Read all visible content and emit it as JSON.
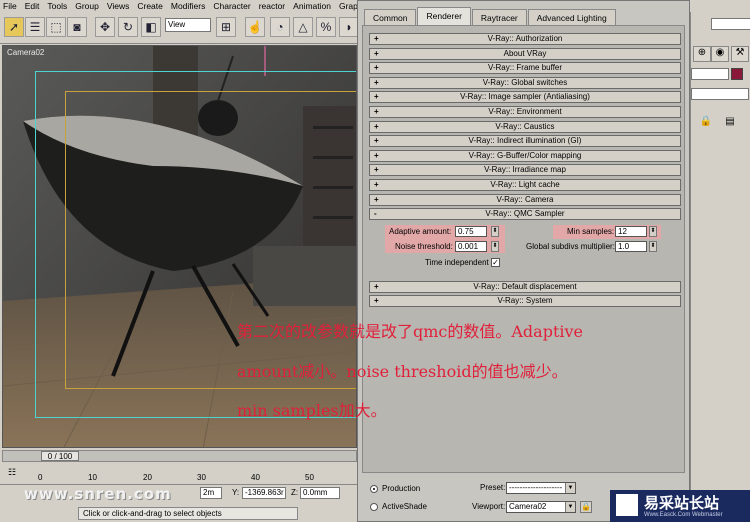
{
  "menu": [
    "File",
    "Edit",
    "Tools",
    "Group",
    "Views",
    "Create",
    "Modifiers",
    "Character",
    "reactor",
    "Animation",
    "Graph Ed"
  ],
  "toolbar": {
    "view_select": "View"
  },
  "viewport": {
    "label": "Camera02"
  },
  "dialog": {
    "tabs": [
      "Common",
      "Renderer",
      "Raytracer",
      "Advanced Lighting"
    ],
    "active_tab": "Renderer",
    "rollouts_before": [
      "V-Ray:: Authorization",
      "About VRay",
      "V-Ray:: Frame buffer",
      "V-Ray:: Global switches",
      "V-Ray:: Image sampler (Antialiasing)",
      "V-Ray:: Environment",
      "V-Ray:: Caustics",
      "V-Ray:: Indirect illumination (GI)",
      "V-Ray:: G-Buffer/Color mapping",
      "V-Ray:: Irradiance map",
      "V-Ray:: Light cache",
      "V-Ray:: Camera"
    ],
    "qmc": {
      "title": "V-Ray:: QMC Sampler",
      "adaptive_amount_label": "Adaptive amount:",
      "adaptive_amount": "0.75",
      "noise_threshold_label": "Noise threshold:",
      "noise_threshold": "0.001",
      "time_independent_label": "Time independent",
      "time_independent_check": "✓",
      "min_samples_label": "Min samples:",
      "min_samples": "12",
      "global_subdivs_label": "Global subdivs multiplier:",
      "global_subdivs": "1.0"
    },
    "rollouts_after": [
      "V-Ray:: Default displacement",
      "V-Ray:: System"
    ],
    "bottom": {
      "production": "Production",
      "activeshade": "ActiveShade",
      "preset_label": "Preset:",
      "preset_value": "--------------------",
      "viewport_label": "Viewport:",
      "viewport_value": "Camera02"
    }
  },
  "annotation": {
    "line1": "第二次的改参数就是改了qmc的数值。Adaptive",
    "line2": "amount减小。noise threshoid的值也减少。",
    "line3": "min samples加大。"
  },
  "timeline": {
    "thumb": "0 / 100",
    "ticks": [
      "0",
      "10",
      "20",
      "30",
      "40",
      "50"
    ]
  },
  "status": {
    "prompt": "Click or click-and-drag to select objects",
    "y_label": "Y:",
    "y_value": "-1369.863r",
    "z_label": "Z:",
    "z_value": "0.0mm",
    "x_value": "2m"
  },
  "watermark": "www.snren.com",
  "logo": {
    "title": "易采站长站",
    "sub": "Www.Easck.Com  Webmaster"
  },
  "colors": {
    "highlight": "#e2a8a8",
    "annotation": "#e0203a",
    "frame_cyan": "#4fd3d0",
    "frame_gold": "#c9a23e"
  }
}
